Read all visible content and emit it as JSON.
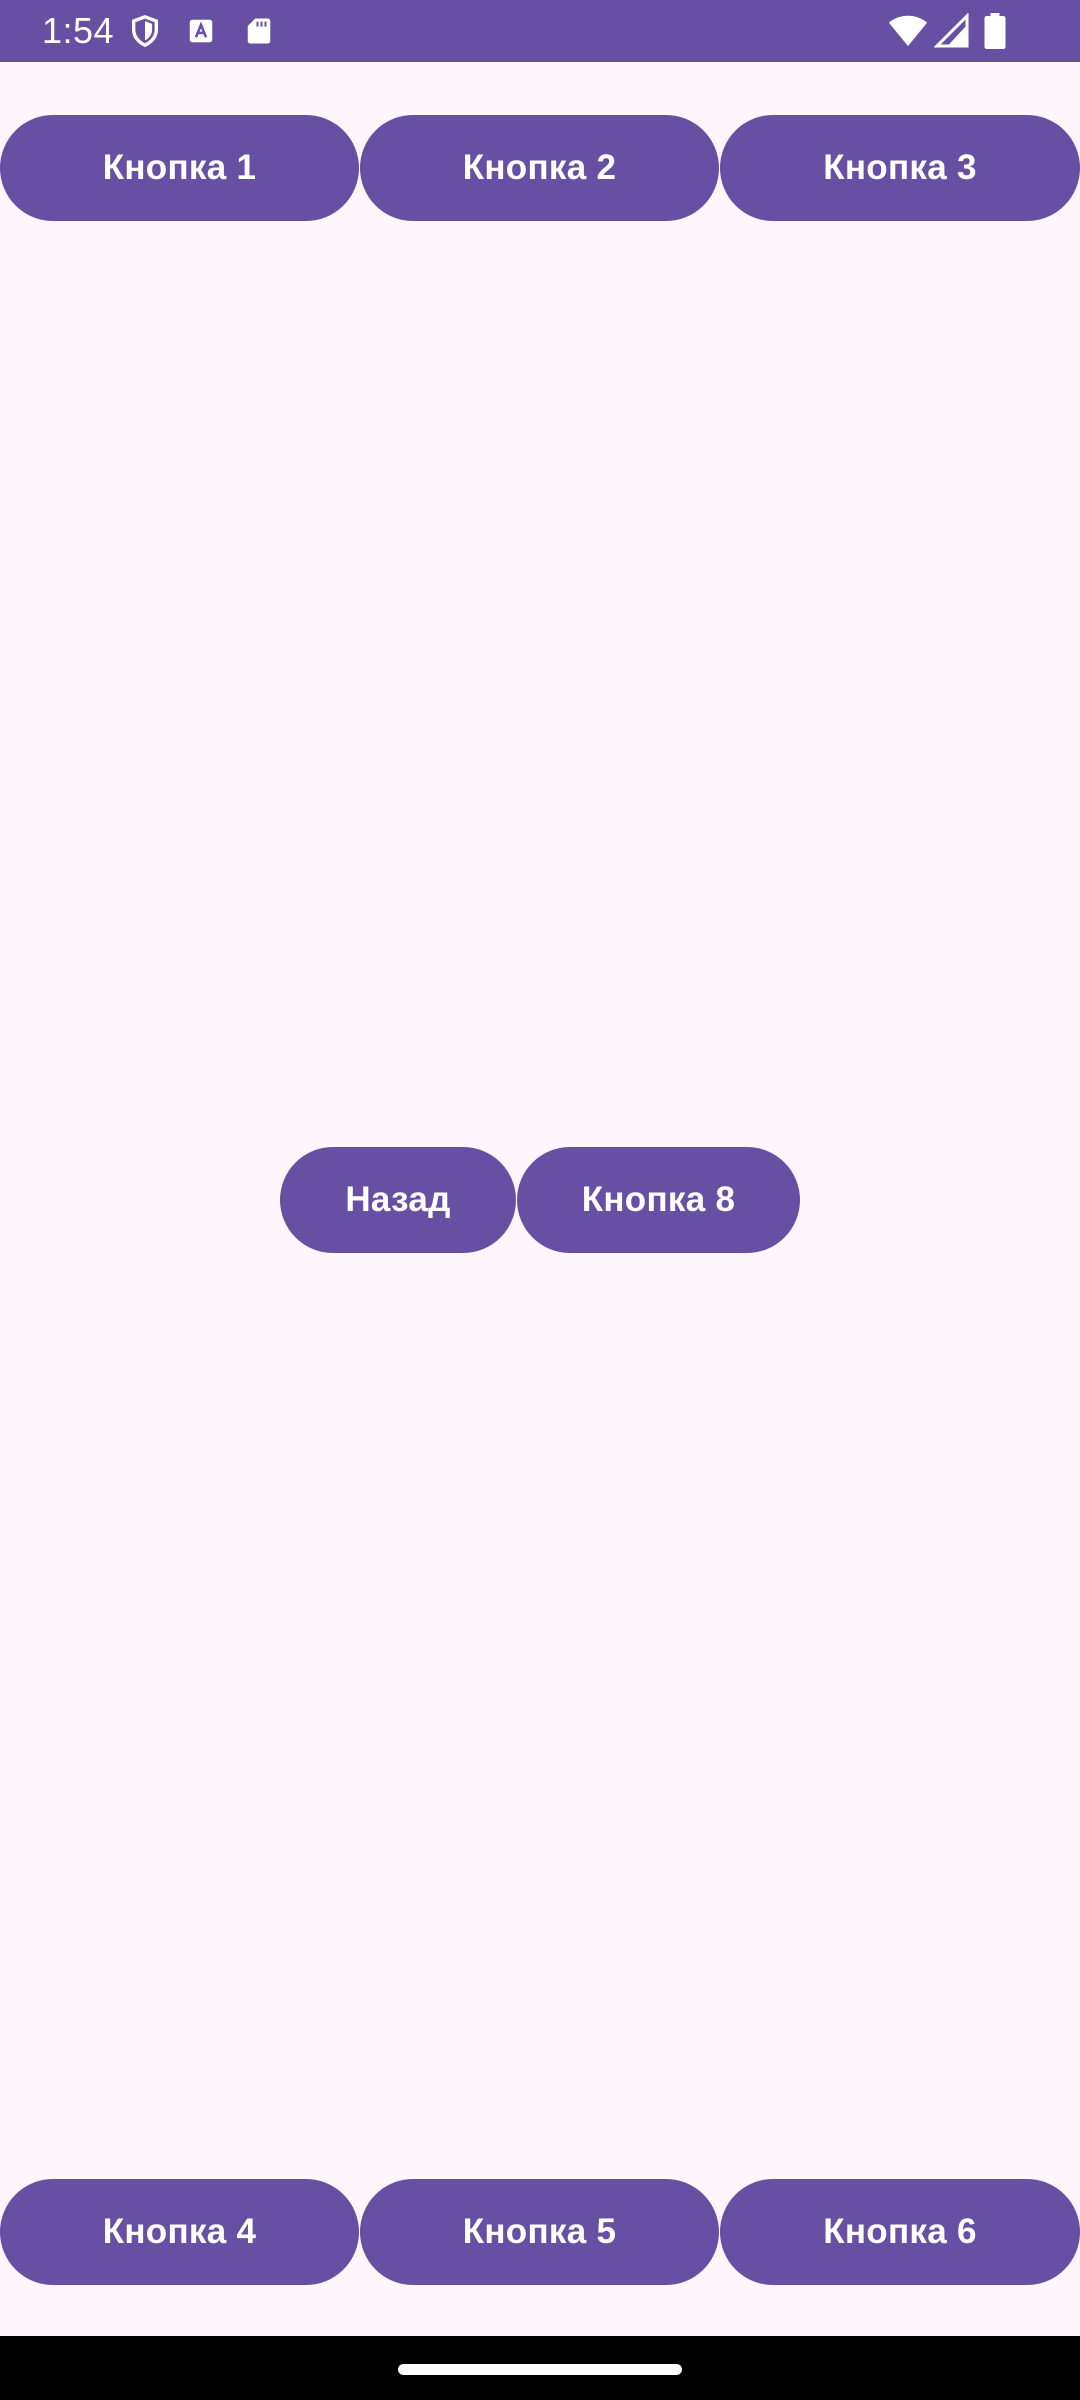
{
  "status_bar": {
    "time": "1:54",
    "icons": [
      "shield-icon",
      "font-icon",
      "sd-card-icon",
      "wifi-icon",
      "signal-icon",
      "battery-icon"
    ]
  },
  "top_buttons": [
    "Кнопка 1",
    "Кнопка 2",
    "Кнопка 3"
  ],
  "middle_buttons": [
    "Назад",
    "Кнопка 8"
  ],
  "bottom_buttons": [
    "Кнопка 4",
    "Кнопка 5",
    "Кнопка 6"
  ],
  "colors": {
    "primary": "#6750A4",
    "background": "#FDF7FD",
    "navbar": "#000000"
  }
}
